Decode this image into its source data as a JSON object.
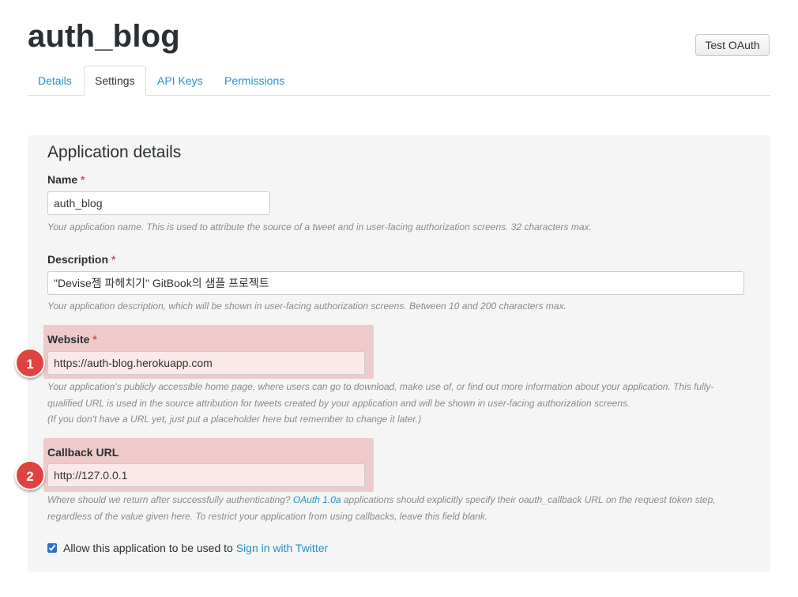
{
  "header": {
    "app_title": "auth_blog",
    "test_oauth_label": "Test OAuth"
  },
  "tabs": [
    {
      "label": "Details",
      "active": false
    },
    {
      "label": "Settings",
      "active": true
    },
    {
      "label": "API Keys",
      "active": false
    },
    {
      "label": "Permissions",
      "active": false
    }
  ],
  "section": {
    "title": "Application details"
  },
  "fields": {
    "name": {
      "label": "Name",
      "required_mark": "*",
      "value": "auth_blog",
      "help": "Your application name. This is used to attribute the source of a tweet and in user-facing authorization screens. 32 characters max."
    },
    "description": {
      "label": "Description",
      "required_mark": "*",
      "value": "\"Devise젬 파헤치기\" GitBook의 샘플 프로젝트",
      "help": "Your application description, which will be shown in user-facing authorization screens. Between 10 and 200 characters max."
    },
    "website": {
      "label": "Website",
      "required_mark": "*",
      "value": "https://auth-blog.herokuapp.com",
      "help_line1": "Your application's publicly accessible home page, where users can go to download, make use of, or find out more information about your application. This fully-",
      "help_line2": "qualified URL is used in the source attribution for tweets created by your application and will be shown in user-facing authorization screens.",
      "help_line3": "(If you don't have a URL yet, just put a placeholder here but remember to change it later.)"
    },
    "callback": {
      "label": "Callback URL",
      "value": "http://127.0.0.1",
      "help_prefix": "Where should we return after successfully authenticating? ",
      "help_link": "OAuth 1.0a",
      "help_suffix": " applications should explicitly specify their oauth_callback URL on the request token step,",
      "help_line2": "regardless of the value given here. To restrict your application from using callbacks, leave this field blank."
    }
  },
  "signin": {
    "checked": true,
    "label": "Allow this application to be used to ",
    "link": "Sign in with Twitter"
  },
  "markers": {
    "website": "1",
    "callback": "2"
  },
  "colors": {
    "link": "#2a8ec8",
    "required": "#d9534f",
    "marker": "#e0433f",
    "highlight": "#e6a0a0"
  }
}
